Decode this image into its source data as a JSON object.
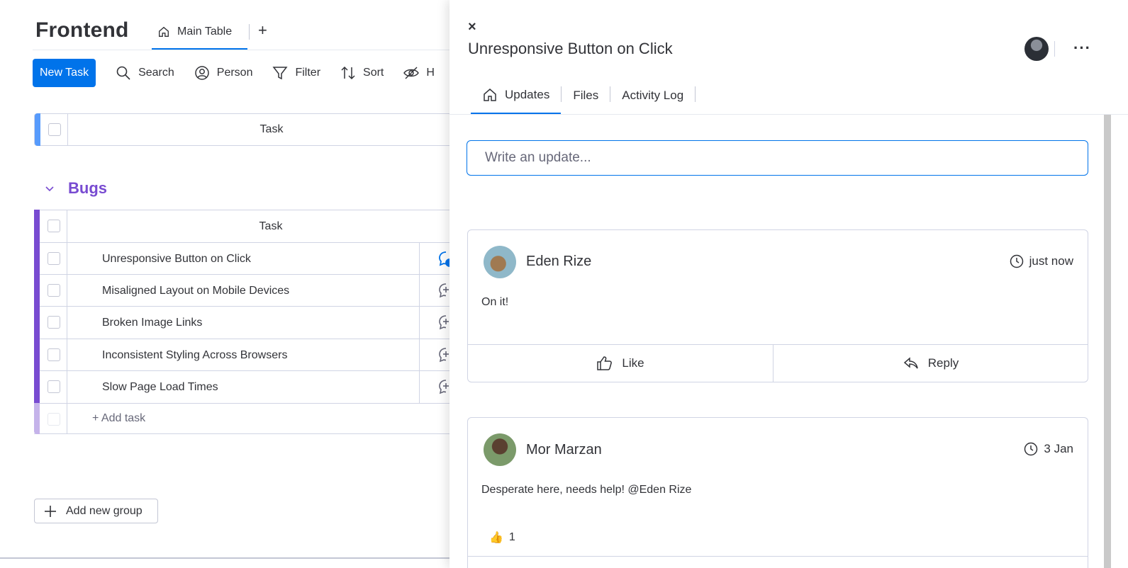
{
  "board": {
    "title": "Frontend",
    "view_tab_label": "Main Table",
    "add_view_label": "+",
    "toolbar": {
      "new_task": "New Task",
      "search": "Search",
      "person": "Person",
      "filter": "Filter",
      "sort": "Sort",
      "hide": "H"
    },
    "top_group": {
      "column_header": "Task",
      "color": "#579bfc"
    },
    "bugs_group": {
      "title": "Bugs",
      "color": "#784bd1",
      "column_header": "Task",
      "tasks": [
        "Unresponsive Button on Click",
        "Misaligned Layout on Mobile Devices",
        "Broken Image Links",
        "Inconsistent Styling Across Browsers",
        "Slow Page Load Times"
      ],
      "add_task": "+ Add task"
    },
    "add_group_label": "Add new group"
  },
  "panel": {
    "close_label": "×",
    "title": "Unresponsive Button on Click",
    "menu_label": "···",
    "tabs": [
      {
        "label": "Updates",
        "icon": "home-icon",
        "active": true
      },
      {
        "label": "Files"
      },
      {
        "label": "Activity Log"
      }
    ],
    "input_placeholder": "Write an update...",
    "updates": [
      {
        "author": "Eden Rize",
        "time": "just now",
        "body": "On it!",
        "like_label": "Like",
        "reply_label": "Reply"
      },
      {
        "author": "Mor Marzan",
        "time": "3 Jan",
        "body": "Desperate here, needs help! @Eden Rize",
        "reaction_emoji": "👍",
        "reaction_count": "1"
      }
    ]
  },
  "colors": {
    "accent": "#0073ea",
    "bugs_purple": "#784bd1",
    "top_group_blue": "#579bfc"
  }
}
